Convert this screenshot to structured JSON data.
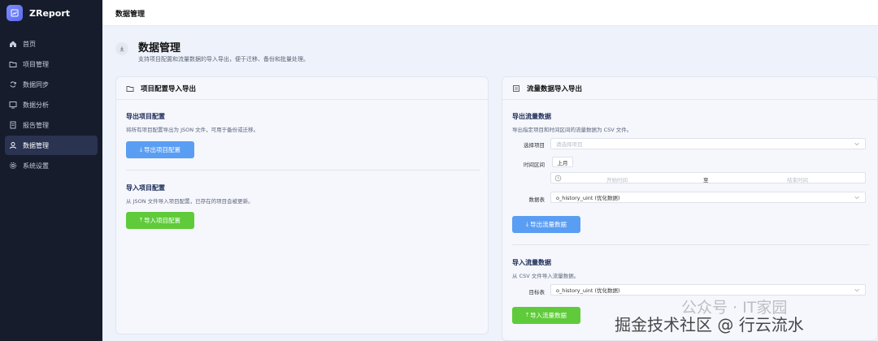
{
  "app": {
    "name": "ZReport"
  },
  "sidebar": {
    "items": [
      {
        "label": "首页",
        "icon": "home-icon"
      },
      {
        "label": "项目管理",
        "icon": "folder-icon"
      },
      {
        "label": "数据同步",
        "icon": "sync-icon"
      },
      {
        "label": "数据分析",
        "icon": "chart-icon"
      },
      {
        "label": "报告管理",
        "icon": "document-icon"
      },
      {
        "label": "数据管理",
        "icon": "user-icon",
        "active": true
      },
      {
        "label": "系统设置",
        "icon": "gear-icon"
      }
    ]
  },
  "topbar": {
    "title": "数据管理"
  },
  "page": {
    "title": "数据管理",
    "description": "支持项目配置和流量数据的导入导出，便于迁移、备份和批量处理。"
  },
  "project_card": {
    "title": "项目配置导入导出",
    "export": {
      "title": "导出项目配置",
      "description": "将所有项目配置导出为 JSON 文件，可用于备份或迁移。",
      "button": "导出项目配置"
    },
    "import": {
      "title": "导入项目配置",
      "description": "从 JSON 文件导入项目配置，已存在的项目会被更新。",
      "button": "导入项目配置"
    }
  },
  "traffic_card": {
    "title": "流量数据导入导出",
    "export": {
      "title": "导出流量数据",
      "description": "导出指定项目和时间区间的流量数据为 CSV 文件。",
      "project_label": "选择项目",
      "project_placeholder": "请选择项目",
      "range_label": "时间区间",
      "range_option": "上月",
      "start_placeholder": "开始时间",
      "range_separator": "至",
      "end_placeholder": "结束时间",
      "table_label": "数据表",
      "table_value": "o_history_uint (优化数据)",
      "button": "导出流量数据"
    },
    "import": {
      "title": "导入流量数据",
      "description": "从 CSV 文件导入流量数据。",
      "target_label": "目标表",
      "target_value": "o_history_uint (优化数据)",
      "button": "导入流量数据"
    }
  },
  "watermark": {
    "line1": "公众号 · IT家园",
    "line2": "掘金技术社区 @ 行云流水"
  },
  "colors": {
    "sidebar_bg": "#161c2c",
    "active_item": "#2a3350",
    "primary": "#5a9ef3",
    "success": "#5fcb3a",
    "page_bg": "#eef2fa"
  }
}
